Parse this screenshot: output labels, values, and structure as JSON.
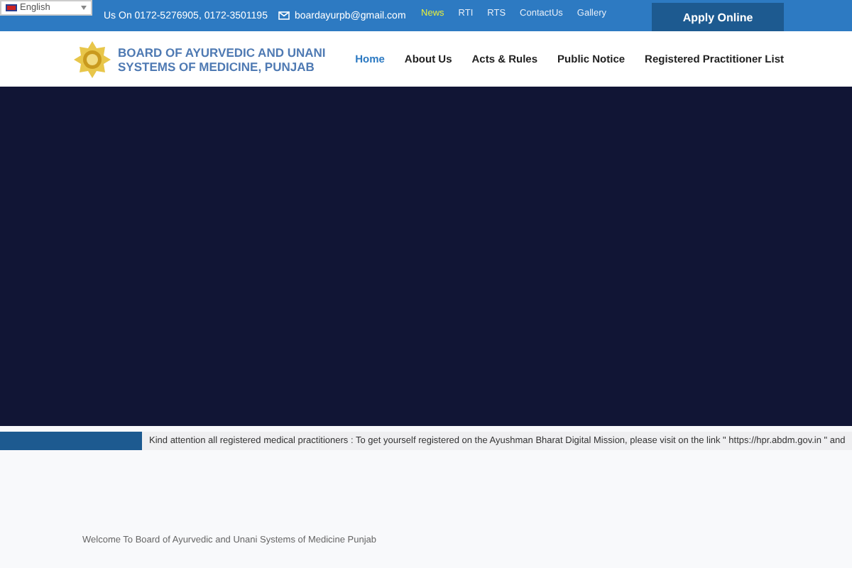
{
  "top_bar": {
    "language": {
      "value": "English"
    },
    "phone": "Us On 0172-5276905, 0172-3501195",
    "email": "boardayurpb@gmail.com",
    "links": [
      {
        "label": "News",
        "selected": true
      },
      {
        "label": "RTI",
        "selected": false
      },
      {
        "label": "RTS",
        "selected": false
      },
      {
        "label": "ContactUs",
        "selected": false
      },
      {
        "label": "Gallery",
        "selected": false
      }
    ],
    "cta": "Apply Online"
  },
  "header": {
    "logo_lines": [
      "BOARD OF AYURVEDIC AND UNANI",
      "SYSTEMS OF MEDICINE, PUNJAB"
    ],
    "nav": [
      {
        "label": "Home",
        "selected": true
      },
      {
        "label": "About Us",
        "selected": false
      },
      {
        "label": "Acts & Rules",
        "selected": false
      },
      {
        "label": "Public Notice",
        "selected": false
      },
      {
        "label": "Registered Practitioner List",
        "selected": false
      }
    ]
  },
  "ticker": {
    "text": "Kind attention all registered medical practitioners : To get yourself registered on the Ayushman Bharat Digital Mission, please visit on the link \" https://hpr.abdm.gov.in \" and"
  },
  "welcome": "Welcome To Board of Ayurvedic and Unani Systems of Medicine Punjab"
}
